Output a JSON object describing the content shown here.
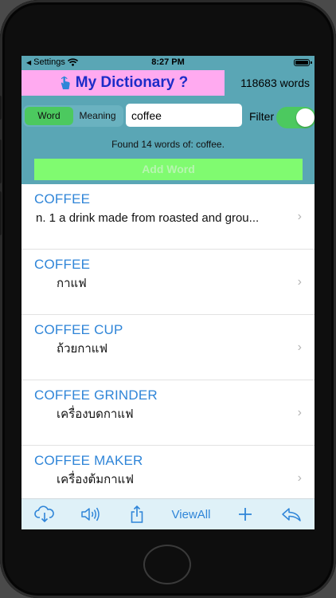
{
  "status": {
    "carrier": "Settings",
    "time": "8:27 PM"
  },
  "header": {
    "title": "My Dictionary ?",
    "word_count": "118683 words",
    "segments": [
      "Word",
      "Meaning"
    ],
    "search_value": "coffee",
    "filter_label": "Filter",
    "found_text": "Found 14 words of: coffee.",
    "add_word_label": "Add Word"
  },
  "colors": {
    "accent": "#2f85d8",
    "header_bg": "#5aa6b5",
    "title_bg": "#ffaaf0",
    "active": "#4cc95f",
    "add_btn": "#80fb70"
  },
  "results": [
    {
      "word": "COFFEE",
      "meaning": "n. 1 a drink made from roasted and grou..."
    },
    {
      "word": "COFFEE",
      "meaning": "กาแฟ"
    },
    {
      "word": "COFFEE CUP",
      "meaning": "ถ้วยกาแฟ"
    },
    {
      "word": "COFFEE GRINDER",
      "meaning": "เครื่องบดกาแฟ"
    },
    {
      "word": "COFFEE MAKER",
      "meaning": "เครื่องต้มกาแฟ"
    }
  ],
  "toolbar": {
    "icons": [
      "cloud-download-icon",
      "speaker-icon",
      "share-icon",
      "plus-icon",
      "reply-icon"
    ],
    "view_all_label": "ViewAll"
  }
}
